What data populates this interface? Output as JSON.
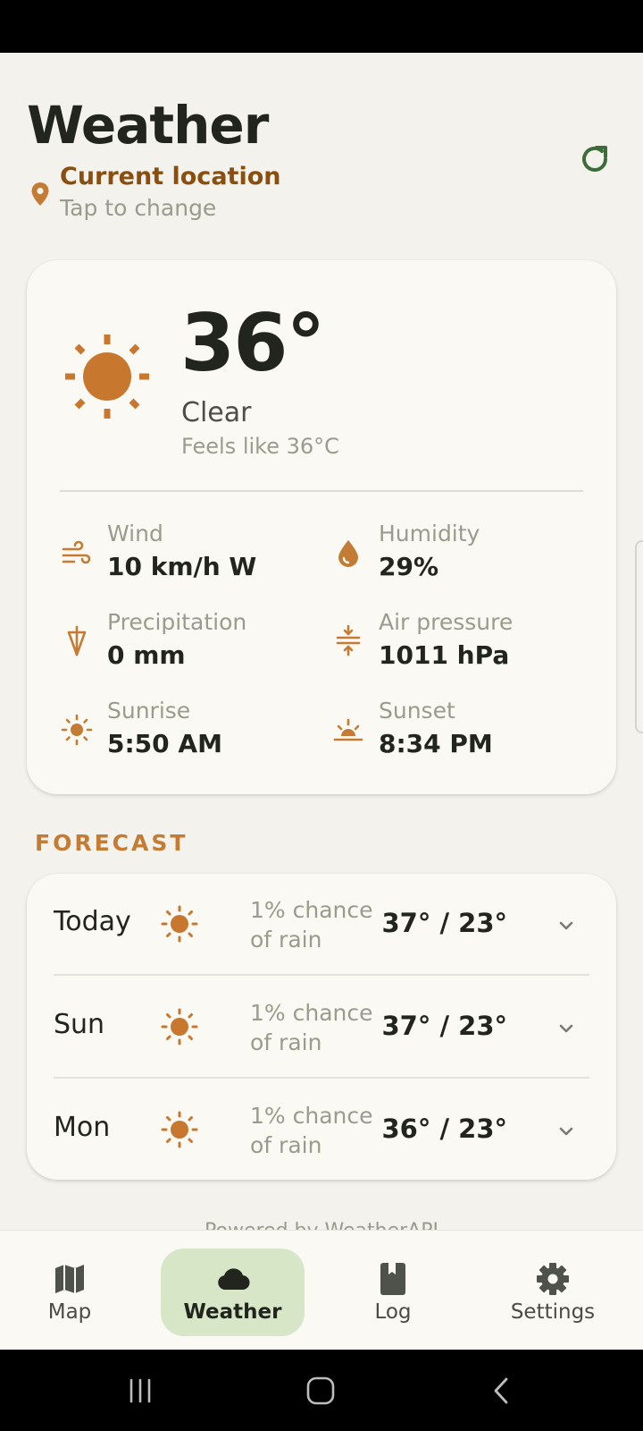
{
  "header": {
    "title": "Weather",
    "location_title": "Current location",
    "location_subtitle": "Tap to change"
  },
  "current": {
    "temperature": "36°",
    "condition": "Clear",
    "feels_like": "Feels like 36°C",
    "metrics": [
      {
        "label": "Wind",
        "value": "10 km/h W",
        "icon": "wind-icon"
      },
      {
        "label": "Humidity",
        "value": "29%",
        "icon": "humidity-icon"
      },
      {
        "label": "Precipitation",
        "value": "0 mm",
        "icon": "umbrella-icon"
      },
      {
        "label": "Air pressure",
        "value": "1011 hPa",
        "icon": "pressure-icon"
      },
      {
        "label": "Sunrise",
        "value": "5:50 AM",
        "icon": "sunrise-icon"
      },
      {
        "label": "Sunset",
        "value": "8:34 PM",
        "icon": "sunset-icon"
      }
    ]
  },
  "forecast": {
    "heading": "FORECAST",
    "days": [
      {
        "day": "Today",
        "rain": "1% chance of rain",
        "temps": "37° / 23°"
      },
      {
        "day": "Sun",
        "rain": "1% chance of rain",
        "temps": "37° / 23°"
      },
      {
        "day": "Mon",
        "rain": "1% chance of rain",
        "temps": "36° / 23°"
      }
    ]
  },
  "powered_by": "Powered by WeatherAPI",
  "nav": {
    "items": [
      {
        "label": "Map",
        "icon": "map-icon"
      },
      {
        "label": "Weather",
        "icon": "cloud-icon",
        "active": true
      },
      {
        "label": "Log",
        "icon": "book-icon"
      },
      {
        "label": "Settings",
        "icon": "gear-icon"
      }
    ]
  },
  "colors": {
    "accent": "#c47c34",
    "location": "#8a4f0f",
    "active_pill": "#d8e6c8",
    "refresh": "#3d6b39"
  }
}
